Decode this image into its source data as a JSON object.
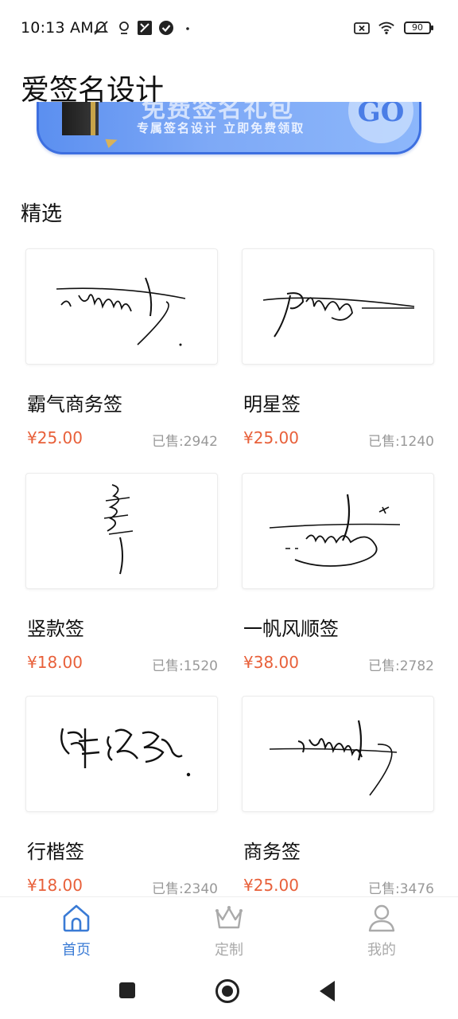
{
  "status_bar": {
    "time": "10:13 AM",
    "battery": "90"
  },
  "app_title": "爱签名设计",
  "banner": {
    "headline": "免费签名礼包",
    "subtitle": "专属签名设计 立即免费领取",
    "go_label": "GO"
  },
  "section_title": "精选",
  "products": [
    {
      "name": "霸气商务签",
      "price": "¥25.00",
      "sold": "已售:2942"
    },
    {
      "name": "明星签",
      "price": "¥25.00",
      "sold": "已售:1240"
    },
    {
      "name": "竖款签",
      "price": "¥18.00",
      "sold": "已售:1520"
    },
    {
      "name": "一帆风顺签",
      "price": "¥38.00",
      "sold": "已售:2782"
    },
    {
      "name": "行楷签",
      "price": "¥18.00",
      "sold": "已售:2340"
    },
    {
      "name": "商务签",
      "price": "¥25.00",
      "sold": "已售:3476"
    }
  ],
  "tabs": [
    {
      "label": "首页",
      "icon": "home-icon",
      "active": true
    },
    {
      "label": "定制",
      "icon": "crown-icon",
      "active": false
    },
    {
      "label": "我的",
      "icon": "user-icon",
      "active": false
    }
  ],
  "colors": {
    "accent": "#3a7bd5",
    "price": "#e8603a",
    "inactive": "#aaaaaa"
  }
}
